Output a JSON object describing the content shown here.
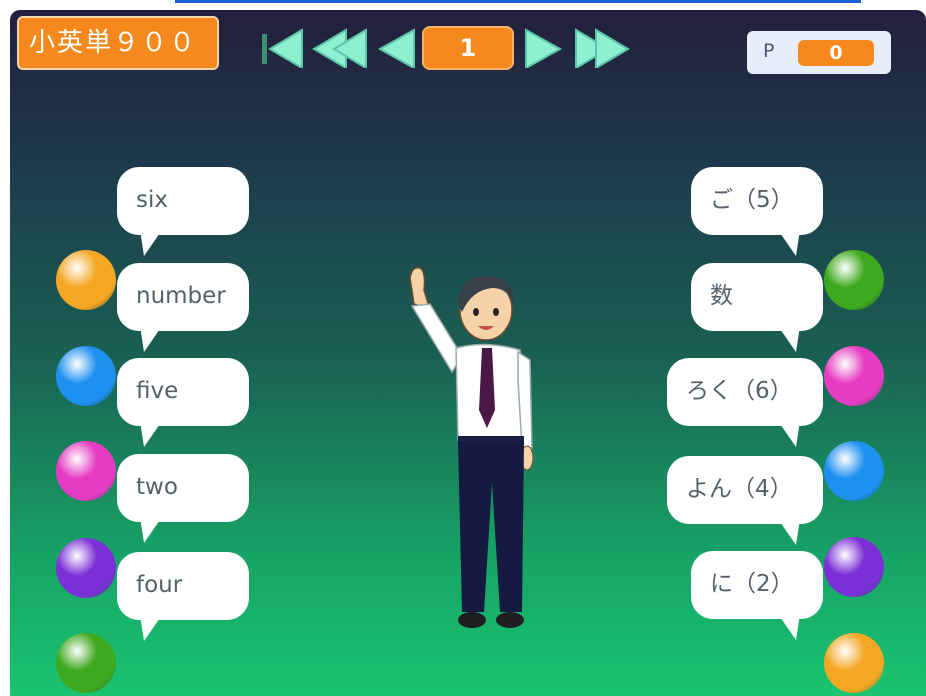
{
  "app": {
    "title": "小英単９００"
  },
  "nav": {
    "page": "1",
    "buttons": [
      "first",
      "rewind",
      "previous",
      "next",
      "fast-forward"
    ]
  },
  "points": {
    "label": "P",
    "value": "0"
  },
  "english_words": [
    "six",
    "number",
    "five",
    "two",
    "four"
  ],
  "japanese_words": [
    "ご（5）",
    "数",
    "ろく（6）",
    "よん（4）",
    "に（2）"
  ],
  "left_balls": [
    "#f5a623",
    "#1e90f0",
    "#e63cc3",
    "#7b2fd6",
    "#3ea81e"
  ],
  "right_balls": [
    "#3ea81e",
    "#e63cc3",
    "#1e90f0",
    "#7b2fd6",
    "#f5a623"
  ],
  "colors": {
    "accent": "#f5891d",
    "nav_arrows": "#8ef0d0",
    "bubble": "#ffffff"
  },
  "character": {
    "name": "teacher",
    "pose": "waving"
  }
}
